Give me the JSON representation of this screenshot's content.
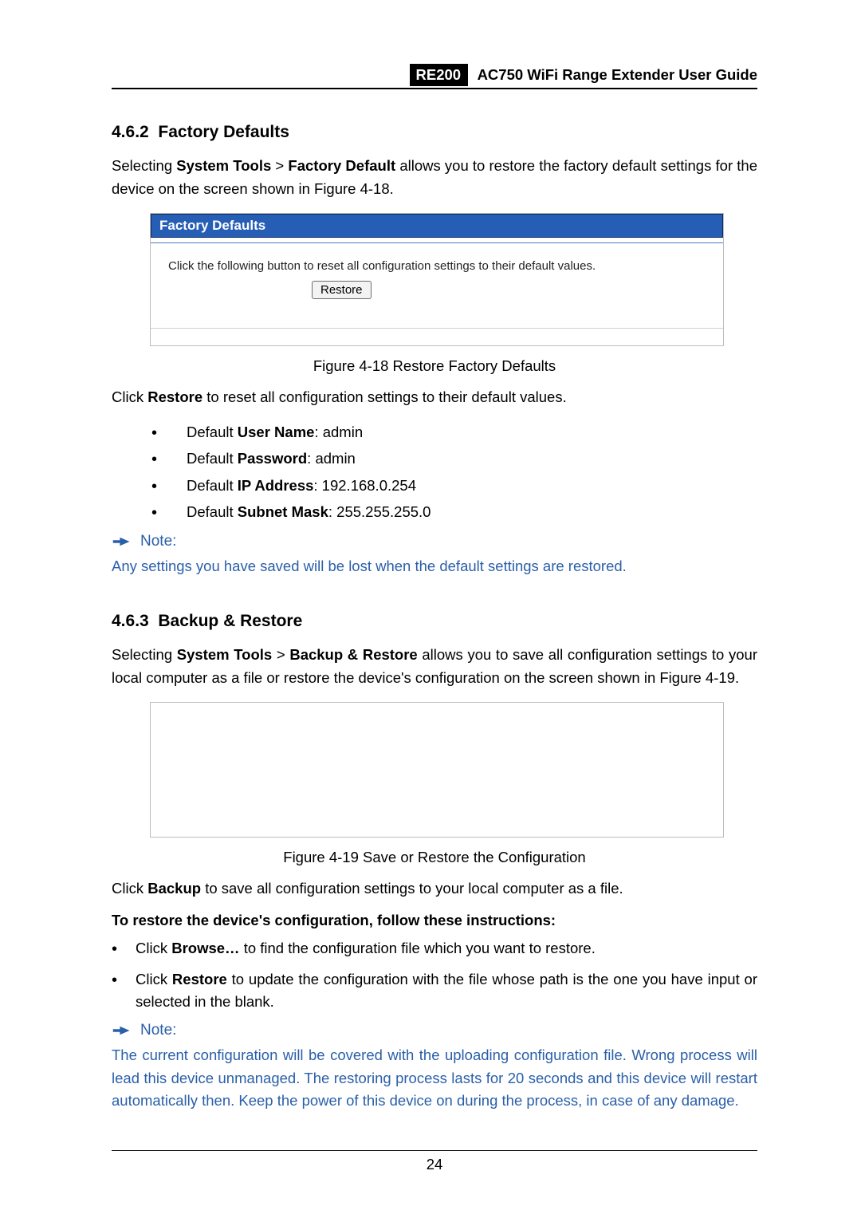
{
  "header": {
    "model": "RE200",
    "title": "AC750 WiFi Range Extender User Guide"
  },
  "section1": {
    "num": "4.6.2",
    "title": "Factory Defaults",
    "para1a": "Selecting ",
    "b1": "System Tools",
    "gt": " > ",
    "b2": "Factory Default",
    "para1b": " allows you to restore the factory default settings for the device on the screen shown in Figure 4-18."
  },
  "figure1": {
    "header": "Factory Defaults",
    "instruction": "Click the following button to reset all configuration settings to their default values.",
    "button": "Restore",
    "caption": "Figure 4-18 Restore Factory Defaults"
  },
  "afterFig1": {
    "click_a": "Click ",
    "click_b": "Restore",
    "click_c": " to reset all configuration settings to their default values.",
    "bullets": [
      {
        "pre": "Default ",
        "b": "User Name",
        "post": ": admin"
      },
      {
        "pre": "Default ",
        "b": "Password",
        "post": ": admin"
      },
      {
        "pre": "Default ",
        "b": "IP Address",
        "post": ": 192.168.0.254"
      },
      {
        "pre": "Default ",
        "b": "Subnet Mask",
        "post": ": 255.255.255.0"
      }
    ]
  },
  "note1": {
    "label": "Note:",
    "text": "Any settings you have saved will be lost when the default settings are restored."
  },
  "section2": {
    "num": "4.6.3",
    "title": "Backup & Restore",
    "para1a": "Selecting ",
    "b1": "System Tools",
    "gt": " > ",
    "b2": "Backup & Restore",
    "para1b": " allows you to save all configuration settings to your local computer as a file or restore the device's configuration on the screen shown in Figure 4-19."
  },
  "figure2": {
    "caption": "Figure 4-19 Save or Restore the Configuration"
  },
  "afterFig2": {
    "click_a": "Click ",
    "click_b": "Backup",
    "click_c": " to save all configuration settings to your local computer as a file.",
    "heading": "To restore the device's configuration, follow these instructions:",
    "bullets": [
      {
        "pre": "Click ",
        "b": "Browse…",
        "post": " to find the configuration file which you want to restore."
      },
      {
        "pre": "Click ",
        "b": "Restore",
        "post": " to update the configuration with the file whose path is the one you have input or selected in the blank."
      }
    ]
  },
  "note2": {
    "label": "Note:",
    "text": "The current configuration will be covered with the uploading configuration file. Wrong process will lead this device unmanaged. The restoring process lasts for 20 seconds and this device will restart automatically then. Keep the power of this device on during the process, in case of any damage."
  },
  "footer": {
    "pageNum": "24"
  }
}
